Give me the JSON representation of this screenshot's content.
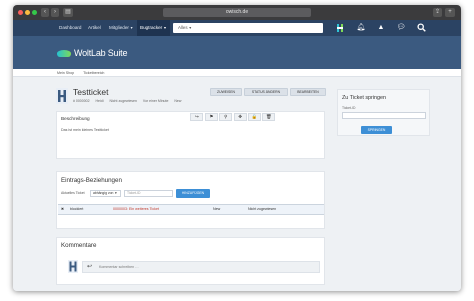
{
  "browser": {
    "url": "owisch.de",
    "back_label": "‹",
    "forward_label": "›",
    "sidebar_toggle_label": "▤"
  },
  "nav": {
    "items": [
      {
        "label": "Dashboard",
        "active": false,
        "dropdown": false
      },
      {
        "label": "Artikel",
        "active": false,
        "dropdown": false
      },
      {
        "label": "Mitglieder",
        "active": false,
        "dropdown": true
      },
      {
        "label": "Bugtracker",
        "active": true,
        "dropdown": true
      }
    ],
    "search_scope": "Alles",
    "icons": [
      "user-icon",
      "bell-icon",
      "alert-icon",
      "chat-icon",
      "search-icon"
    ]
  },
  "brand": {
    "name": "WoltLab Suite"
  },
  "breadcrumbs": [
    "Mein Shop",
    "Ticketbereich"
  ],
  "ticket": {
    "title": "Testticket",
    "meta": [
      "# 0000002",
      "Heidi",
      "Nicht zugewiesen",
      "Vor einer Minute",
      "New"
    ],
    "actions": [
      "ZUWEISEN",
      "STATUS ÄNDERN",
      "BEARBEITEN"
    ]
  },
  "jump": {
    "heading": "Zu Ticket springen",
    "label": "Ticket-ID",
    "button": "SPRINGEN"
  },
  "description": {
    "heading": "Beschreibung",
    "text": "Das ist mein kleines Testticket"
  },
  "toolbar": {
    "icons": [
      "share-icon",
      "flag-icon",
      "pin-icon",
      "move-icon",
      "lock-icon",
      "trash-icon"
    ],
    "glyphs": [
      "↪",
      "⚑",
      "⚲",
      "✥",
      "🔒",
      "🗑"
    ]
  },
  "relations": {
    "heading": "Eintrags-Beziehungen",
    "current_label": "Aktuelles Ticket",
    "select_value": "abhängig von",
    "input_placeholder": "Ticket-ID",
    "add_button": "HINZUFÜGEN",
    "rows": [
      {
        "type": "blockiert",
        "ticket": "0000003: Ein weiteres Ticket",
        "status": "New",
        "assignee": "Nicht zugewiesen"
      }
    ]
  },
  "comments": {
    "heading": "Kommentare",
    "placeholder": "Kommentar schreiben …"
  },
  "colors": {
    "nav": "#2b4363",
    "banner": "#3b5a80",
    "accent": "#3d8fd6",
    "link_red": "#c0392b"
  }
}
